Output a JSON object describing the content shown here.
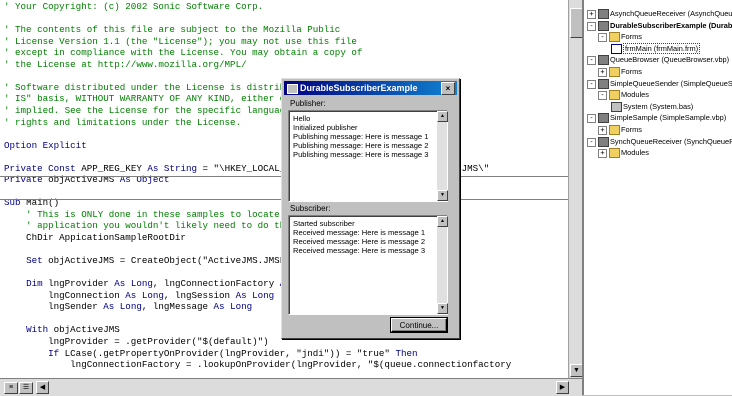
{
  "editor": {
    "lines": [
      [
        {
          "t": "' Your Copyright: (c) 2002 Sonic Software Corp.",
          "c": "comment"
        }
      ],
      [],
      [
        {
          "t": "' The contents of this file are subject to the Mozilla Public",
          "c": "comment"
        }
      ],
      [
        {
          "t": "' License Version 1.1 (the \"License\"); you may not use this file",
          "c": "comment"
        }
      ],
      [
        {
          "t": "' except in compliance with the License. You may obtain a copy of",
          "c": "comment"
        }
      ],
      [
        {
          "t": "' the License at http://www.mozilla.org/MPL/",
          "c": "comment"
        }
      ],
      [],
      [
        {
          "t": "' Software distributed under the License is distributed on an \"AS",
          "c": "comment"
        }
      ],
      [
        {
          "t": "' IS\" basis, WITHOUT WARRANTY OF ANY KIND, either express or",
          "c": "comment"
        }
      ],
      [
        {
          "t": "' implied. See the License for the specific language governing",
          "c": "comment"
        }
      ],
      [
        {
          "t": "' rights and limitations under the License.",
          "c": "comment"
        }
      ],
      [],
      [
        {
          "t": "Option Explicit",
          "c": "kw"
        }
      ],
      [],
      [
        {
          "t": "Private Const ",
          "c": "kw"
        },
        {
          "t": "APP_REG_KEY ",
          "c": "plain"
        },
        {
          "t": "As String ",
          "c": "kw"
        },
        {
          "t": "= \"\\HKEY_LOCAL_MACHINE\\SOFTWARE\\Sonic Software\\JMS\\\"",
          "c": "plain"
        }
      ],
      [
        {
          "t": "Private ",
          "c": "kw"
        },
        {
          "t": "objActiveJMS ",
          "c": "plain"
        },
        {
          "t": "As Object",
          "c": "kw"
        }
      ],
      [],
      [
        {
          "t": "Sub ",
          "c": "kw"
        },
        {
          "t": "Main()",
          "c": "plain"
        }
      ],
      [
        {
          "t": "    ' This is ONLY done in these samples to locate the files in a normal",
          "c": "comment"
        }
      ],
      [
        {
          "t": "    ' application you wouldn't likely need to do this",
          "c": "comment"
        }
      ],
      [
        {
          "t": "    ChDir AppicationSampleRootDir",
          "c": "plain"
        }
      ],
      [],
      [
        {
          "t": "    ",
          "c": "plain"
        },
        {
          "t": "Set ",
          "c": "kw"
        },
        {
          "t": "objActiveJMS = CreateObject(\"ActiveJMS.JMSFactory\")",
          "c": "plain"
        }
      ],
      [],
      [
        {
          "t": "    ",
          "c": "plain"
        },
        {
          "t": "Dim ",
          "c": "kw"
        },
        {
          "t": "lngProvider ",
          "c": "plain"
        },
        {
          "t": "As Long",
          "c": "kw"
        },
        {
          "t": ", lngConnectionFactory ",
          "c": "plain"
        },
        {
          "t": "As Long",
          "c": "kw"
        }
      ],
      [
        {
          "t": "        lngConnection ",
          "c": "plain"
        },
        {
          "t": "As Long",
          "c": "kw"
        },
        {
          "t": ", lngSession ",
          "c": "plain"
        },
        {
          "t": "As Long",
          "c": "kw"
        }
      ],
      [
        {
          "t": "        lngSender ",
          "c": "plain"
        },
        {
          "t": "As Long",
          "c": "kw"
        },
        {
          "t": ", lngMessage ",
          "c": "plain"
        },
        {
          "t": "As Long",
          "c": "kw"
        }
      ],
      [],
      [
        {
          "t": "    ",
          "c": "plain"
        },
        {
          "t": "With ",
          "c": "kw"
        },
        {
          "t": "objActiveJMS",
          "c": "plain"
        }
      ],
      [
        {
          "t": "        lngProvider = .getProvider(\"$(default)\")",
          "c": "plain"
        }
      ],
      [
        {
          "t": "        ",
          "c": "plain"
        },
        {
          "t": "If ",
          "c": "kw"
        },
        {
          "t": "LCase(.getPropertyOnProvider(lngProvider, \"jndi\")) = \"true\" ",
          "c": "plain"
        },
        {
          "t": "Then",
          "c": "kw"
        }
      ],
      [
        {
          "t": "            lngConnectionFactory = .lookupOnProvider(lngProvider, \"$(queue.connectionfactory",
          "c": "plain"
        }
      ]
    ],
    "colors": {
      "comment": "#008000",
      "keyword": "#000080",
      "text": "#000000"
    }
  },
  "dialog": {
    "title": "DurableSubscriberExample",
    "close_glyph": "×",
    "publisher_label": "Publisher:",
    "publisher_lines": [
      "Hello",
      "Initialized publisher",
      "Publishing message: Here is message 1",
      "Publishing message: Here is message 2",
      "Publishing message: Here is message 3"
    ],
    "subscriber_label": "Subscriber:",
    "subscriber_lines": [
      "Started subscriber",
      "Received message: Here is message 1",
      "Received message: Here is message 2",
      "Received message: Here is message 3"
    ],
    "continue_label": "Continue..."
  },
  "explorer": {
    "items": [
      {
        "indent": 0,
        "expander": "+",
        "icon": "project",
        "label": "AsynchQueueReceiver (AsynchQueueReceiver.vbp)",
        "bold": false
      },
      {
        "indent": 0,
        "expander": "-",
        "icon": "project",
        "label": "DurableSubscriberExample (DurableSubscriberExample.vbp)",
        "bold": true
      },
      {
        "indent": 1,
        "expander": "-",
        "icon": "folder",
        "label": "Forms",
        "bold": false
      },
      {
        "indent": 2,
        "expander": "",
        "icon": "form",
        "label": "frmMain (frmMain.frm)",
        "bold": false,
        "selected": true
      },
      {
        "indent": 0,
        "expander": "-",
        "icon": "project",
        "label": "QueueBrowser (QueueBrowser.vbp)",
        "bold": false
      },
      {
        "indent": 1,
        "expander": "+",
        "icon": "folder",
        "label": "Forms",
        "bold": false
      },
      {
        "indent": 0,
        "expander": "-",
        "icon": "project",
        "label": "SimpleQueueSender (SimpleQueueSender.vbp)",
        "bold": false
      },
      {
        "indent": 1,
        "expander": "-",
        "icon": "folder",
        "label": "Modules",
        "bold": false
      },
      {
        "indent": 2,
        "expander": "",
        "icon": "module",
        "label": "System (System.bas)",
        "bold": false
      },
      {
        "indent": 0,
        "expander": "-",
        "icon": "project",
        "label": "SimpleSample (SimpleSample.vbp)",
        "bold": false
      },
      {
        "indent": 1,
        "expander": "+",
        "icon": "folder",
        "label": "Forms",
        "bold": false
      },
      {
        "indent": 0,
        "expander": "-",
        "icon": "project",
        "label": "SynchQueueReceiver (SynchQueueReceiver.vbp)",
        "bold": false
      },
      {
        "indent": 1,
        "expander": "+",
        "icon": "folder",
        "label": "Modules",
        "bold": false
      }
    ]
  },
  "scrollbar": {
    "up": "▲",
    "down": "▼",
    "left": "◀",
    "right": "▶"
  }
}
